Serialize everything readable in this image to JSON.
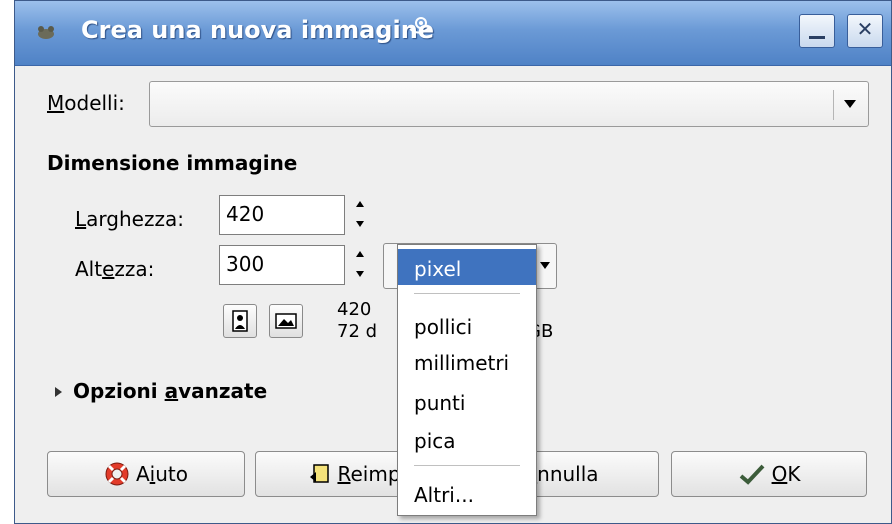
{
  "window": {
    "title": "Crea una nuova immagine"
  },
  "templates": {
    "label_first": "M",
    "label_rest": "odelli:",
    "value": ""
  },
  "image_size": {
    "heading": "Dimensione immagine",
    "width_label_first": "L",
    "width_label_rest": "arghezza:",
    "width_value": "420",
    "height_label_a": "Alt",
    "height_label_u": "e",
    "height_label_b": "zza:",
    "height_value": "300",
    "unit_selected": "pixel",
    "info_line1": "420",
    "info_line2": "72 d",
    "info_line2_tail": "GB"
  },
  "advanced": {
    "label_a": "Opzioni ",
    "label_u": "a",
    "label_b": "vanzate"
  },
  "buttons": {
    "help_a": "A",
    "help_u": "i",
    "help_b": "uto",
    "reset_u": "R",
    "reset_b": "eimp",
    "cancel_u": "A",
    "cancel_b": "nnulla",
    "ok_u": "O",
    "ok_b": "K"
  },
  "unit_menu": {
    "items": [
      "pixel",
      "pollici",
      "millimetri",
      "punti",
      "pica",
      "Altri..."
    ],
    "selected_index": 0
  }
}
